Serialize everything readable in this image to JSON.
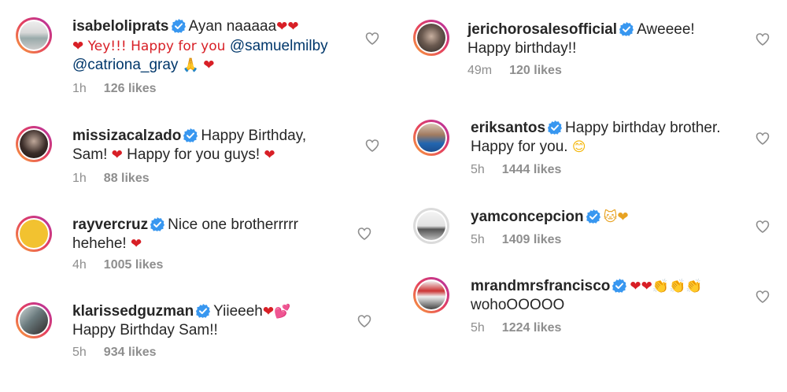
{
  "comments": [
    {
      "user": "isabeloliprats",
      "line1": "Ayan naaaaa",
      "line1_emoji": "❤❤",
      "line2_pre": "❤ Yey!!! Happy for you ",
      "mention1": "@samuelmilby",
      "mention2": "@catriona_gray",
      "line3_emoji": "🙏 ❤",
      "time": "1h",
      "likes": "126 likes"
    },
    {
      "user": "missizacalzado",
      "line1": "Happy Birthday,",
      "line2": "Sam! ",
      "line2_emoji": "❤",
      "line2_b": " Happy for you guys! ",
      "line2_emoji2": "❤",
      "time": "1h",
      "likes": "88 likes"
    },
    {
      "user": "rayvercruz",
      "line1": "Nice one brotherrrrr",
      "line2": "hehehe! ",
      "line2_emoji": "❤",
      "time": "4h",
      "likes": "1005 likes"
    },
    {
      "user": "klarissedguzman",
      "line1": "Yiieeeh",
      "line1_emoji": "❤💕",
      "line2": "Happy Birthday Sam!!",
      "time": "5h",
      "likes": "934 likes"
    },
    {
      "user": "jerichorosalesofficial",
      "line1": "Aweeee!",
      "line2": "Happy birthday!!",
      "time": "49m",
      "likes": "120 likes"
    },
    {
      "user": "eriksantos",
      "line1": "Happy birthday brother.",
      "line2": "Happy for you. ",
      "line2_emoji": "😊",
      "time": "5h",
      "likes": "1444 likes"
    },
    {
      "user": "yamconcepcion",
      "line1_emoji": "🐱❤",
      "time": "5h",
      "likes": "1409 likes"
    },
    {
      "user": "mrandmrsfrancisco",
      "line1_emoji": "❤❤",
      "line1_emoji2": "👏👏👏",
      "line2": "wohoOOOOO",
      "time": "5h",
      "likes": "1224 likes"
    }
  ],
  "colors": {
    "verified": "#3897f0",
    "heart_outline": "#8e8e8e",
    "meta": "#8e8e8e"
  },
  "icons": {
    "verified": "verified-badge-icon",
    "like": "heart-outline-icon"
  }
}
